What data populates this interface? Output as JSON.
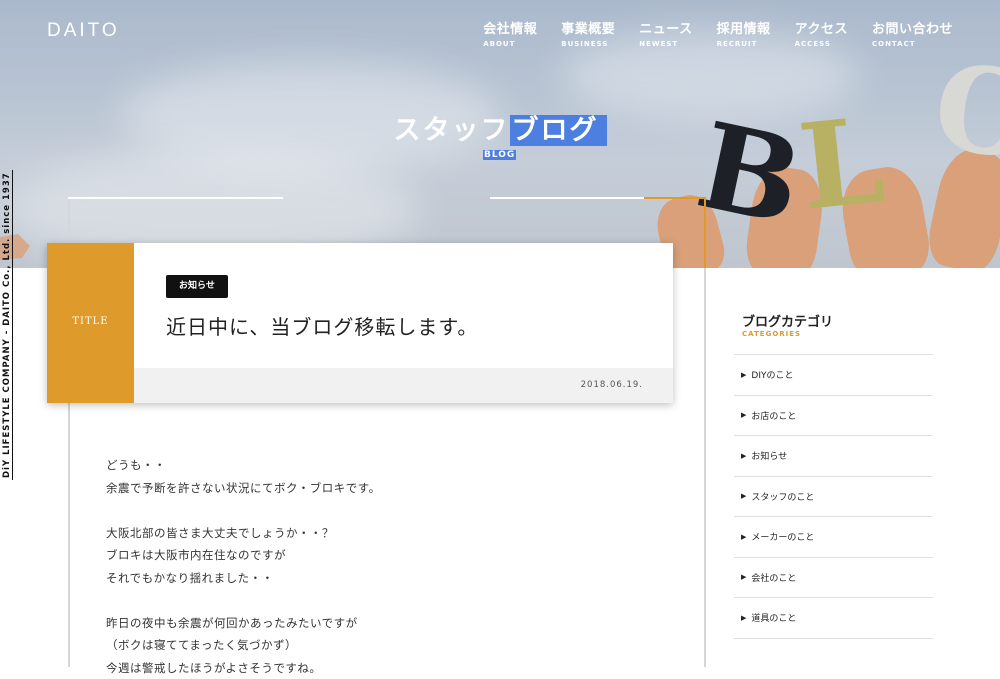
{
  "header": {
    "logo": "DAITO",
    "nav": [
      {
        "jp": "会社情報",
        "en": "ABOUT"
      },
      {
        "jp": "事業概要",
        "en": "BUSINESS"
      },
      {
        "jp": "ニュース",
        "en": "NEWEST"
      },
      {
        "jp": "採用情報",
        "en": "RECRUIT"
      },
      {
        "jp": "アクセス",
        "en": "ACCESS"
      },
      {
        "jp": "お問い合わせ",
        "en": "CONTACT"
      }
    ]
  },
  "hero": {
    "title_plain": "スタッフ",
    "title_highlight": "ブログ",
    "subtitle": "BLOG",
    "highlight_color": "#4d7fe0",
    "letters": [
      "B",
      "L",
      "O"
    ]
  },
  "side_text": "DiY LIFESTYLE COMPANY - DAITO Co., Ltd. since 1937",
  "post": {
    "title_label": "TITLE",
    "category": "お知らせ",
    "title": "近日中に、当ブログ移転します。",
    "date": "2018.06.19.",
    "accent_color": "#de9a2b",
    "body": [
      "どうも・・",
      "余震で予断を許さない状況にてボク・ブロキです。",
      "",
      "大阪北部の皆さま大丈夫でしょうか・・？",
      "ブロキは大阪市内在住なのですが",
      "それでもかなり揺れました・・",
      "",
      "昨日の夜中も余震が何回かあったみたいですが",
      "（ボクは寝ててまったく気づかず）",
      "今週は警戒したほうがよさそうですね。"
    ]
  },
  "sidebar": {
    "title": "ブログカテゴリ",
    "subtitle": "CATEGORIES",
    "items": [
      "DIYのこと",
      "お店のこと",
      "お知らせ",
      "スタッフのこと",
      "メーカーのこと",
      "会社のこと",
      "道具のこと"
    ]
  }
}
